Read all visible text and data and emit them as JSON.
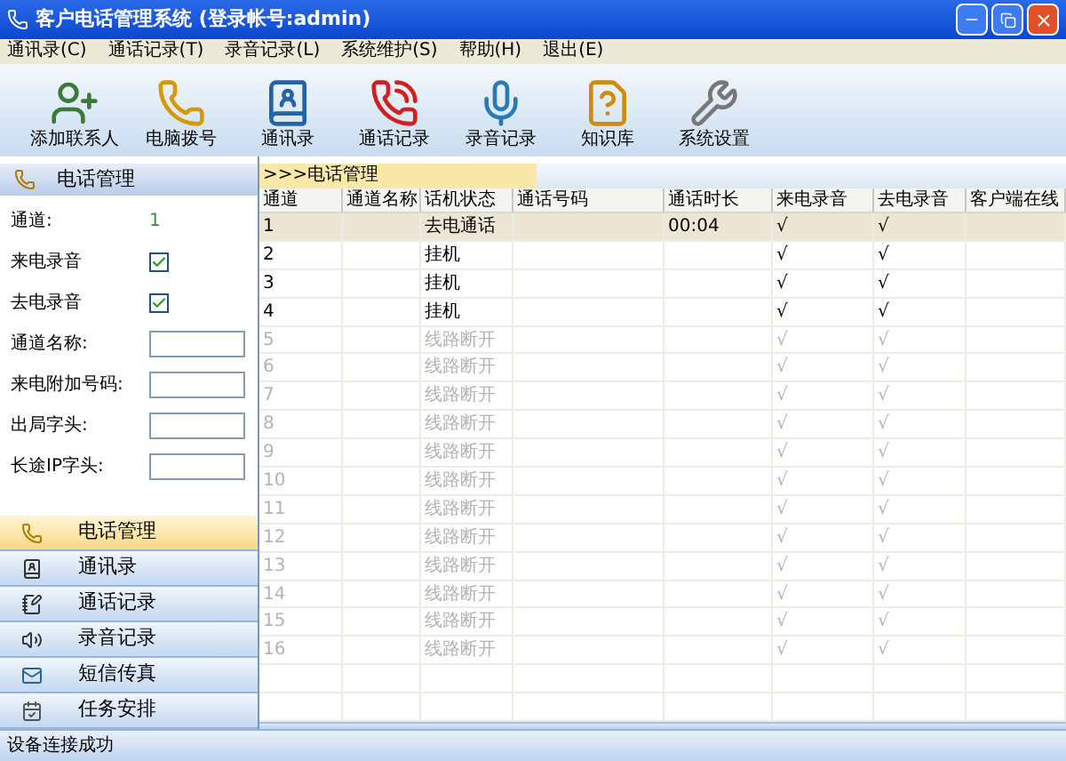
{
  "window": {
    "title": "客户电话管理系统 (登录帐号:admin)"
  },
  "menu": [
    "通讯录(C)",
    "通话记录(T)",
    "录音记录(L)",
    "系统维护(S)",
    "帮助(H)",
    "退出(E)"
  ],
  "toolbar": [
    {
      "kind": "add-contact",
      "label": "添加联系人"
    },
    {
      "kind": "dial",
      "label": "电脑拨号"
    },
    {
      "kind": "contacts",
      "label": "通讯录"
    },
    {
      "kind": "call-log",
      "label": "通话记录"
    },
    {
      "kind": "recording",
      "label": "录音记录"
    },
    {
      "kind": "knowledge",
      "label": "知识库"
    },
    {
      "kind": "settings",
      "label": "系统设置"
    }
  ],
  "panel": {
    "title": "电话管理",
    "fields": [
      {
        "kind": "value",
        "label": "通道:",
        "value": "1"
      },
      {
        "kind": "checkbox",
        "label": "来电录音",
        "checked": true
      },
      {
        "kind": "checkbox",
        "label": "去电录音",
        "checked": true
      },
      {
        "kind": "input",
        "label": "通道名称:"
      },
      {
        "kind": "input",
        "label": "来电附加号码:"
      },
      {
        "kind": "input",
        "label": "出局字头:"
      },
      {
        "kind": "input",
        "label": "长途IP字头:"
      }
    ]
  },
  "nav": [
    {
      "kind": "phone",
      "label": "电话管理",
      "selected": true
    },
    {
      "kind": "contacts",
      "label": "通讯录",
      "selected": false
    },
    {
      "kind": "call-log",
      "label": "通话记录",
      "selected": false
    },
    {
      "kind": "recording",
      "label": "录音记录",
      "selected": false
    },
    {
      "kind": "sms",
      "label": "短信传真",
      "selected": false
    },
    {
      "kind": "tasks",
      "label": "任务安排",
      "selected": false
    }
  ],
  "breadcrumb": ">>>电话管理",
  "table": {
    "columns": [
      "通道",
      "通道名称",
      "话机状态",
      "通话号码",
      "通话时长",
      "来电录音",
      "去电录音",
      "客户端在线"
    ],
    "rows": [
      {
        "selected": true,
        "disabled": false,
        "cells": [
          "1",
          "",
          "去电通话",
          "",
          "00:04",
          "√",
          "√",
          ""
        ]
      },
      {
        "selected": false,
        "disabled": false,
        "cells": [
          "2",
          "",
          "挂机",
          "",
          "",
          "√",
          "√",
          ""
        ]
      },
      {
        "selected": false,
        "disabled": false,
        "cells": [
          "3",
          "",
          "挂机",
          "",
          "",
          "√",
          "√",
          ""
        ]
      },
      {
        "selected": false,
        "disabled": false,
        "cells": [
          "4",
          "",
          "挂机",
          "",
          "",
          "√",
          "√",
          ""
        ]
      },
      {
        "selected": false,
        "disabled": true,
        "cells": [
          "5",
          "",
          "线路断开",
          "",
          "",
          "√",
          "√",
          ""
        ]
      },
      {
        "selected": false,
        "disabled": true,
        "cells": [
          "6",
          "",
          "线路断开",
          "",
          "",
          "√",
          "√",
          ""
        ]
      },
      {
        "selected": false,
        "disabled": true,
        "cells": [
          "7",
          "",
          "线路断开",
          "",
          "",
          "√",
          "√",
          ""
        ]
      },
      {
        "selected": false,
        "disabled": true,
        "cells": [
          "8",
          "",
          "线路断开",
          "",
          "",
          "√",
          "√",
          ""
        ]
      },
      {
        "selected": false,
        "disabled": true,
        "cells": [
          "9",
          "",
          "线路断开",
          "",
          "",
          "√",
          "√",
          ""
        ]
      },
      {
        "selected": false,
        "disabled": true,
        "cells": [
          "10",
          "",
          "线路断开",
          "",
          "",
          "√",
          "√",
          ""
        ]
      },
      {
        "selected": false,
        "disabled": true,
        "cells": [
          "11",
          "",
          "线路断开",
          "",
          "",
          "√",
          "√",
          ""
        ]
      },
      {
        "selected": false,
        "disabled": true,
        "cells": [
          "12",
          "",
          "线路断开",
          "",
          "",
          "√",
          "√",
          ""
        ]
      },
      {
        "selected": false,
        "disabled": true,
        "cells": [
          "13",
          "",
          "线路断开",
          "",
          "",
          "√",
          "√",
          ""
        ]
      },
      {
        "selected": false,
        "disabled": true,
        "cells": [
          "14",
          "",
          "线路断开",
          "",
          "",
          "√",
          "√",
          ""
        ]
      },
      {
        "selected": false,
        "disabled": true,
        "cells": [
          "15",
          "",
          "线路断开",
          "",
          "",
          "√",
          "√",
          ""
        ]
      },
      {
        "selected": false,
        "disabled": true,
        "cells": [
          "16",
          "",
          "线路断开",
          "",
          "",
          "√",
          "√",
          ""
        ]
      }
    ]
  },
  "status_bar": "设备连接成功"
}
